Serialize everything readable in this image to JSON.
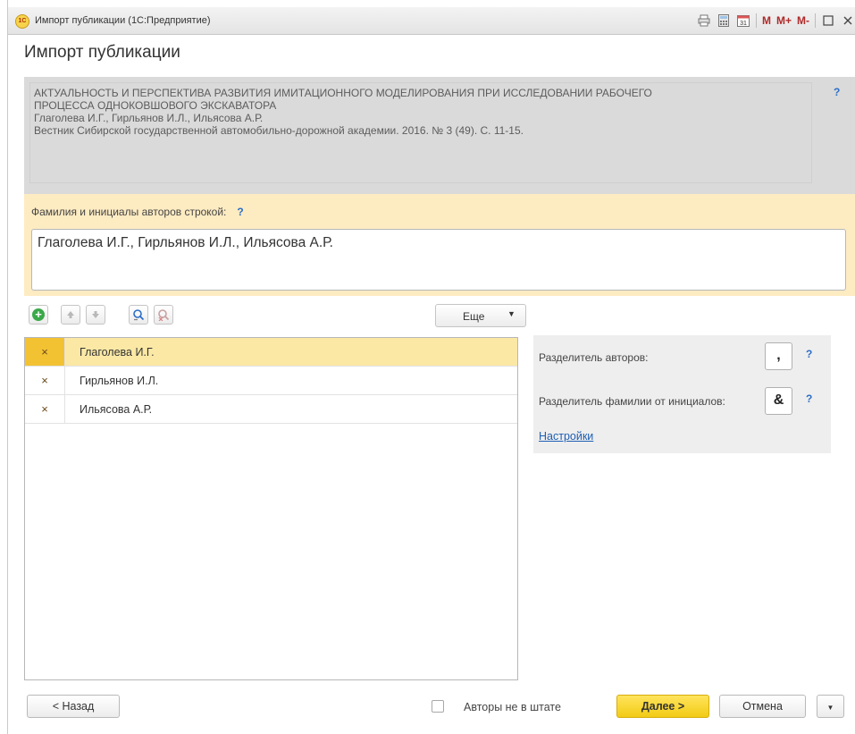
{
  "window": {
    "title": "Импорт публикации  (1С:Предприятие)",
    "logo_text": "1С",
    "toolbar_icons": [
      "print-icon",
      "calculator-icon",
      "calendar-icon"
    ],
    "memory_buttons": [
      "M",
      "M+",
      "M-"
    ]
  },
  "form": {
    "title": "Импорт публикации"
  },
  "publication": {
    "lines": [
      "АКТУАЛЬНОСТЬ И ПЕРСПЕКТИВА РАЗВИТИЯ ИМИТАЦИОННОГО МОДЕЛИРОВАНИЯ ПРИ ИССЛЕДОВАНИИ РАБОЧЕГО",
      "ПРОЦЕССА ОДНОКОВШОВОГО ЭКСКАВАТОРА",
      "Глаголева И.Г., Гирльянов И.Л., Ильясова А.Р.",
      "Вестник Сибирской государственной автомобильно-дорожной академии.  2016.  № 3 (49).  С. 11-15."
    ],
    "help": "?"
  },
  "authors": {
    "label": "Фамилия и инициалы авторов строкой:",
    "help": "?",
    "value": "Глаголева И.Г., Гирльянов И.Л., Ильясова А.Р."
  },
  "toolbar": {
    "more_label": "Еще"
  },
  "list": {
    "rows": [
      {
        "delete": "×",
        "name": "Глаголева И.Г.",
        "selected": true
      },
      {
        "delete": "×",
        "name": "Гирльянов И.Л.",
        "selected": false
      },
      {
        "delete": "×",
        "name": "Ильясова А.Р.",
        "selected": false
      }
    ]
  },
  "separators": {
    "authors_label": "Разделитель авторов:",
    "authors_value": ",",
    "name_label": "Разделитель фамилии от инициалов:",
    "name_value": "&",
    "help": "?",
    "settings_link": "Настройки"
  },
  "footer": {
    "back_label": "< Назад",
    "checkbox_label": "Авторы не в штате",
    "checkbox_checked": false,
    "next_label": "Далее >",
    "cancel_label": "Отмена"
  },
  "colors": {
    "accent_yellow": "#f2c233",
    "selected_row": "#fbe8a5",
    "authors_section": "#fdebc2",
    "publication_box": "#dadada",
    "link": "#1e5fb4",
    "help": "#2c6ec7"
  }
}
